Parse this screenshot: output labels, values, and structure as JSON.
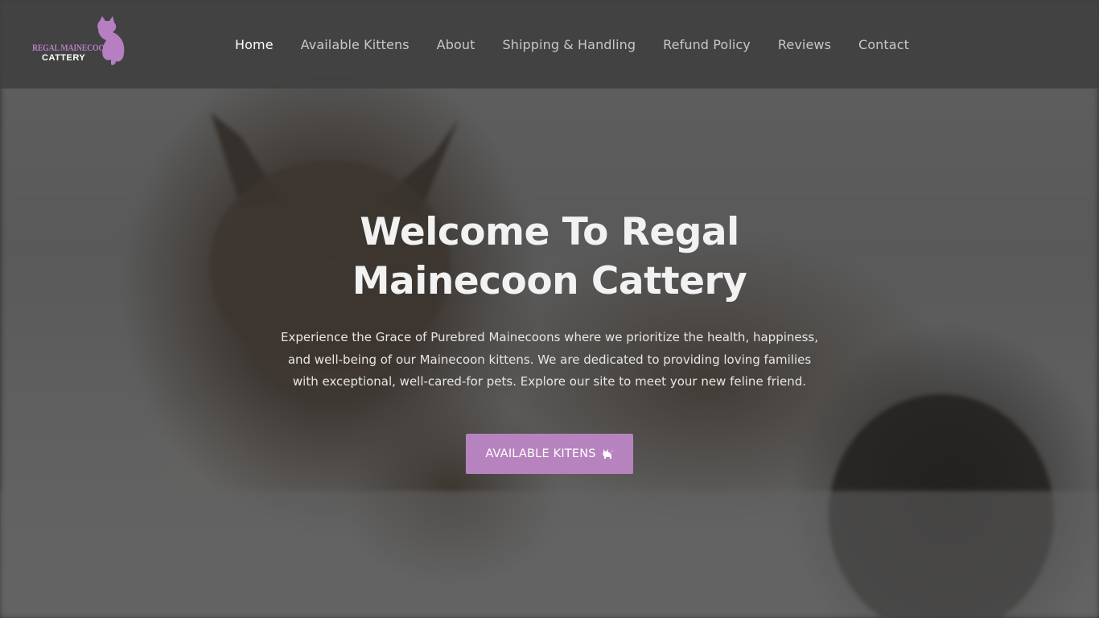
{
  "brand": {
    "logo_line1": "REGAL MAINECOON",
    "logo_line2": "CATTERY",
    "logo_icon": "cat-silhouette-icon",
    "accent_color": "#b783be"
  },
  "nav": {
    "items": [
      {
        "label": "Home",
        "active": true
      },
      {
        "label": "Available Kittens",
        "active": false
      },
      {
        "label": "About",
        "active": false
      },
      {
        "label": "Shipping & Handling",
        "active": false
      },
      {
        "label": "Refund Policy",
        "active": false
      },
      {
        "label": "Reviews",
        "active": false
      },
      {
        "label": "Contact",
        "active": false
      }
    ]
  },
  "hero": {
    "title": "Welcome To Regal Mainecoon Cattery",
    "description": "Experience the Grace of Purebred Mainecoons where we prioritize the health, happiness, and well-being of our Mainecoon kittens. We are dedicated to providing loving families with exceptional, well-cared-for pets. Explore our site to meet your new feline friend.",
    "cta_label": "AVAILABLE KITENS",
    "cta_icon": "cat-icon",
    "background_image": "maine-coon-cat-photo"
  }
}
